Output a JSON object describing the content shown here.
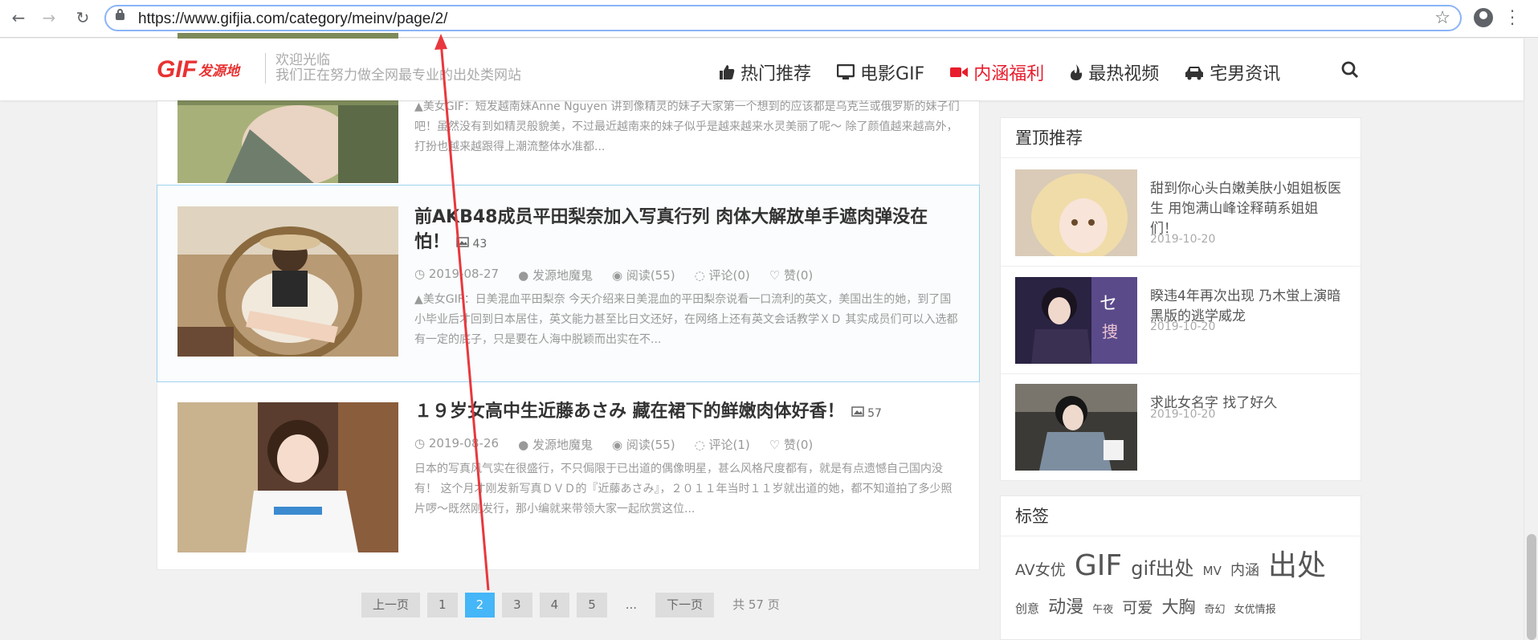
{
  "browser": {
    "url": "https://www.gifjia.com/category/meinv/page/2/"
  },
  "header": {
    "logo_text": "GIF发源地",
    "tagline_line1": "欢迎光临",
    "tagline_line2": "我们正在努力做全网最专业的出处类网站",
    "nav": [
      {
        "label": "热门推荐",
        "icon": "thumbs-up-icon"
      },
      {
        "label": "电影GIF",
        "icon": "monitor-icon"
      },
      {
        "label": "内涵福利",
        "icon": "video-camera-icon",
        "active": true
      },
      {
        "label": "最热视频",
        "icon": "fire-icon"
      },
      {
        "label": "宅男资讯",
        "icon": "car-icon"
      }
    ]
  },
  "posts": [
    {
      "excerpt": "▲美女GIF：短发越南妹Anne Nguyen 讲到像精灵的妹子大家第一个想到的应该都是乌克兰或俄罗斯的妹子们吧！虽然没有到如精灵般貌美，不过最近越南来的妹子似乎是越来越来水灵美丽了呢～ 除了颜值越来越高外，打扮也越来越跟得上潮流整体水准都..."
    },
    {
      "title": "前AKB48成员平田梨奈加入写真行列 肉体大解放单手遮肉弹没在怕！",
      "img_count": "43",
      "date": "2019-08-27",
      "author": "发源地魔鬼",
      "views": "阅读(55)",
      "comments": "评论(0)",
      "likes": "赞(0)",
      "excerpt": "▲美女GIF：日美混血平田梨奈 今天介绍来日美混血的平田梨奈说看一口流利的英文，美国出生的她，到了国小毕业后才回到日本居住，英文能力甚至比日文还好，在网络上还有英文会话教学ＸＤ 其实成员们可以入选都有一定的底子，只是要在人海中脱颖而出实在不..."
    },
    {
      "title": "１９岁女高中生近藤あさみ 藏在裙下的鲜嫩肉体好香！",
      "img_count": "57",
      "date": "2019-08-26",
      "author": "发源地魔鬼",
      "views": "阅读(55)",
      "comments": "评论(1)",
      "likes": "赞(0)",
      "excerpt": "日本的写真风气实在很盛行，不只侷限于已出道的偶像明星，甚么风格尺度都有，就是有点遗憾自己国内没有！ 这个月才刚发新写真ＤＶＤ的『近藤あさみ』，２０１１年当时１１岁就出道的她，都不知道拍了多少照片啰～既然刚发行，那小编就来带领大家一起欣赏这位..."
    }
  ],
  "pagination": {
    "prev": "上一页",
    "pages": [
      "1",
      "2",
      "3",
      "4",
      "5"
    ],
    "current": "2",
    "dots": "...",
    "next": "下一页",
    "total": "共 57 页"
  },
  "sidebar": {
    "top_title": "置顶推荐",
    "top_items": [
      {
        "title": "甜到你心头白嫩美肤小姐姐板医生 用饱满山峰诠释萌系姐姐们！",
        "date": "2019-10-20"
      },
      {
        "title": "睽违4年再次出现 乃木蛍上演暗黑版的逃学威龙",
        "date": "2019-10-20"
      },
      {
        "title": "求此女名字 找了好久",
        "date": "2019-10-20"
      }
    ],
    "tags_title": "标签",
    "tags": [
      {
        "label": "AV女优",
        "size": "m"
      },
      {
        "label": "GIF",
        "size": "xl"
      },
      {
        "label": "gif出处",
        "size": "l"
      },
      {
        "label": "MV",
        "size": "s"
      },
      {
        "label": "内涵",
        "size": "m"
      },
      {
        "label": "出处",
        "size": "xl"
      },
      {
        "label": "创意",
        "size": "s"
      },
      {
        "label": "动漫",
        "size": "l"
      },
      {
        "label": "午夜",
        "size": "xs"
      },
      {
        "label": "可爱",
        "size": "m"
      },
      {
        "label": "大胸",
        "size": "l"
      },
      {
        "label": "奇幻",
        "size": "xs"
      },
      {
        "label": "女优情报",
        "size": "xs"
      }
    ]
  },
  "colors": {
    "accent_blue": "#45b6f7",
    "nav_active_red": "#e81c2c",
    "annotation_arrow": "#e8383d"
  }
}
